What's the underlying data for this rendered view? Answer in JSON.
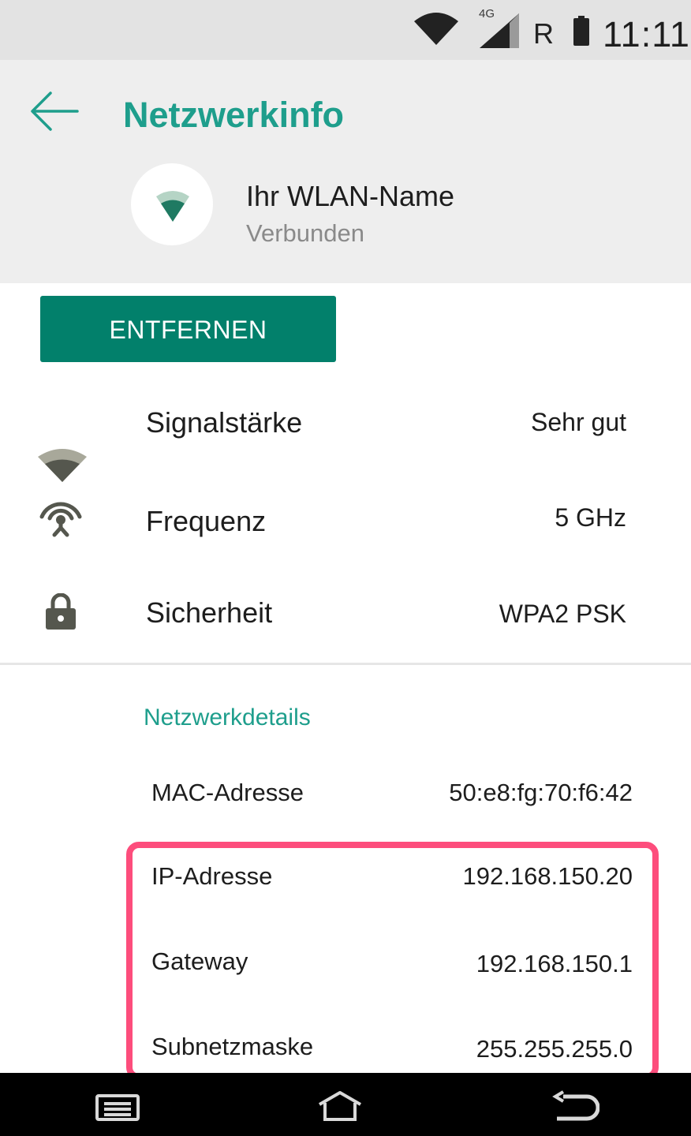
{
  "status_bar": {
    "network_type": "4G",
    "roaming": "R",
    "time": "11:11",
    "icons": [
      "wifi-icon",
      "cell-signal-icon",
      "battery-icon"
    ]
  },
  "header": {
    "title": "Netzwerkinfo",
    "network_name": "Ihr WLAN-Name",
    "connection_state": "Verbunden"
  },
  "actions": {
    "remove_label": "ENTFERNEN"
  },
  "info_rows": [
    {
      "icon": "wifi-signal-icon",
      "label": "Signalstärke",
      "value": "Sehr gut"
    },
    {
      "icon": "antenna-icon",
      "label": "Frequenz",
      "value": "5 GHz"
    },
    {
      "icon": "lock-icon",
      "label": "Sicherheit",
      "value": "WPA2 PSK"
    }
  ],
  "details": {
    "section_title": "Netzwerkdetails",
    "rows": [
      {
        "label": "MAC-Adresse",
        "value": "50:e8:fg:70:f6:42"
      },
      {
        "label": "IP-Adresse",
        "value": "192.168.150.20"
      },
      {
        "label": "Gateway",
        "value": "192.168.150.1"
      },
      {
        "label": "Subnetzmaske",
        "value": "255.255.255.0"
      }
    ]
  },
  "colors": {
    "accent": "#1e9e8c",
    "button": "#02806b",
    "highlight": "#fd4d7c",
    "header_bg": "#eeeeee",
    "status_bg": "#e3e3e3"
  },
  "nav_bar": {
    "buttons": [
      "recent-apps-icon",
      "home-icon",
      "back-icon"
    ]
  }
}
